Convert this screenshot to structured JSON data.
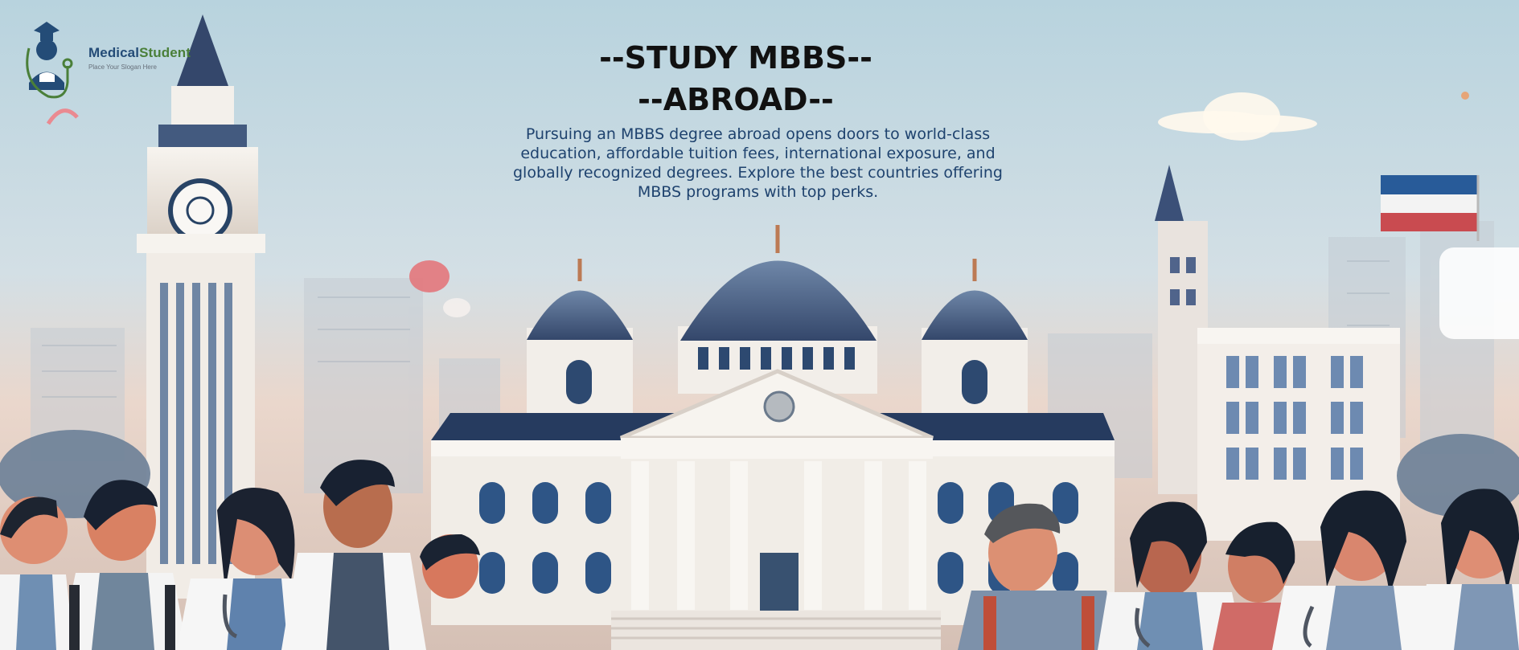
{
  "logo": {
    "name_part_1": "Medical",
    "name_part_2": "Student",
    "tagline": "Place Your Slogan Here",
    "icon": "graduate-stethoscope-icon"
  },
  "hero": {
    "title_line_1": "--STUDY MBBS--",
    "title_line_2": "--ABROAD--",
    "description": "Pursuing an MBBS degree abroad opens doors to world-class education, affordable tuition fees, international exposure, and globally recognized degrees. Explore the best countries offering MBBS programs with top perks."
  },
  "colors": {
    "sky": "#b9d3df",
    "title": "#111111",
    "body_text": "#1e426e",
    "logo_green": "#4a7f39",
    "logo_blue": "#244c77",
    "dome_blue": "#3f557f",
    "building_cream": "#f0ece6",
    "coat_white": "#f5f5f5",
    "shirt_blue": "#6f8fb3"
  },
  "image": {
    "scene": "university-building-with-medical-students"
  }
}
